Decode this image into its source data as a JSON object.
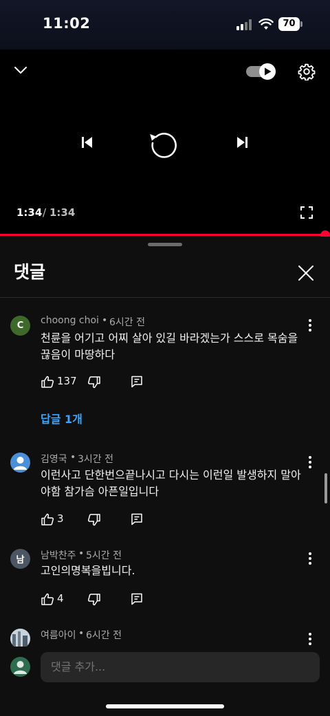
{
  "status_bar": {
    "time": "11:02",
    "battery": "70"
  },
  "player": {
    "current_time": "1:34",
    "separator": "/",
    "duration": "1:34",
    "progress": 1.0,
    "autoplay_on": true
  },
  "comments_panel": {
    "title": "댓글",
    "comments": [
      {
        "author": "choong choi",
        "age": "6시간 전",
        "avatar_letter": "C",
        "avatar_color": "#3d6a2b",
        "text": "천륜을 어기고 어찌 살아 있길 바라겠는가  스스로 목숨을 끊음이 마땅하다",
        "likes": "137",
        "reply_label": "답글 1개"
      },
      {
        "author": "김영국",
        "age": "3시간 전",
        "avatar_color": "#4a8fd8",
        "text": "이런사고 단한번으끝나시고 다시는 이런일 발생하지 말아야함 참가슴 아픈일입니다",
        "likes": "3"
      },
      {
        "author": "남박찬주",
        "age": "5시간 전",
        "avatar_letter": "남",
        "avatar_color": "#4b5563",
        "text": "고인의명복을빕니다.",
        "likes": "4"
      },
      {
        "author": "여름아이",
        "age": "6시간 전",
        "avatar_color": "#7c8a96"
      }
    ],
    "meta_separator": "•"
  },
  "composer": {
    "placeholder": "댓글 추가...",
    "avatar_color": "#2e6b4f"
  },
  "colors": {
    "accent": "#ff0033",
    "link": "#3ea6ff"
  }
}
